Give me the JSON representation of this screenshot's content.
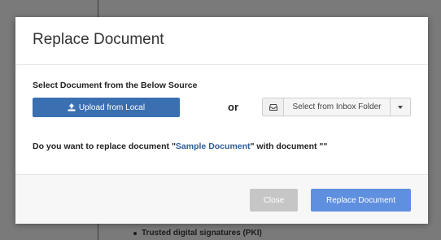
{
  "background_page": {
    "list_items": [
      "",
      "Trusted digital signatures (PKI)"
    ]
  },
  "modal": {
    "title": "Replace Document",
    "source_label": "Select Document from the Below Source",
    "upload_button": {
      "label": "Upload from Local",
      "icon": "upload-icon"
    },
    "or_text": "or",
    "inbox_dropdown": {
      "label": "Select from Inbox Folder",
      "icon": "inbox-icon"
    },
    "question": {
      "prefix": "Do you want to replace document \"",
      "document_name": "Sample Document",
      "middle": "\" with document \"",
      "new_document_name": "",
      "suffix": "\""
    },
    "footer": {
      "close_label": "Close",
      "replace_label": "Replace Document"
    }
  },
  "colors": {
    "primary": "#3a6fb1",
    "replace_button": "#5f8fdf",
    "close_button_disabled": "#c6c6c6",
    "document_name": "#2f5f9a"
  }
}
